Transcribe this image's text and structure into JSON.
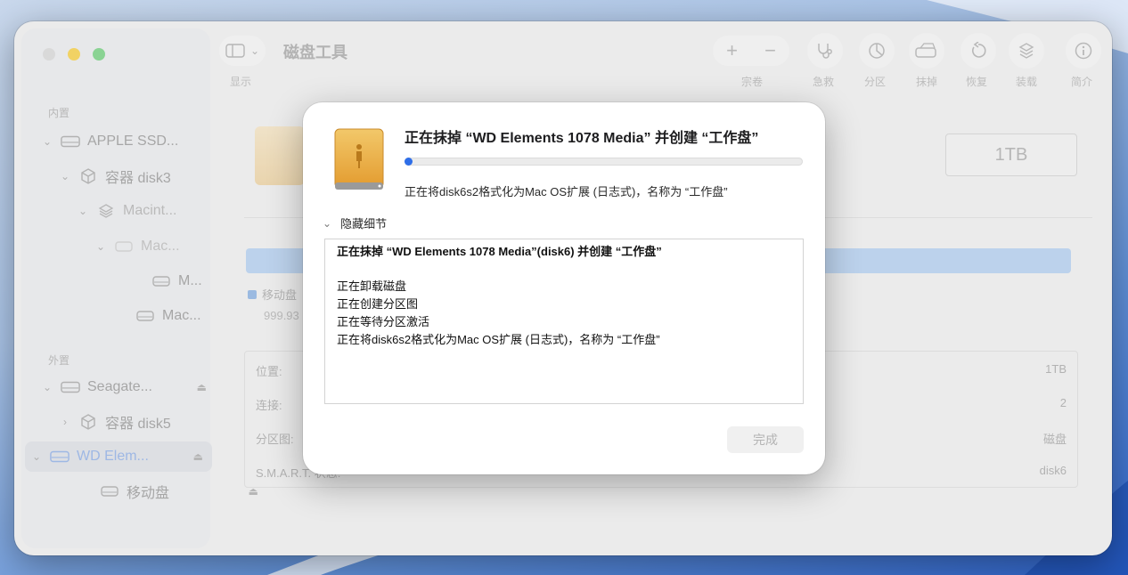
{
  "toolbar": {
    "title": "磁盘工具",
    "view_label": "显示",
    "volume_label": "宗卷",
    "first_aid_label": "急救",
    "partition_label": "分区",
    "erase_label": "抹掉",
    "restore_label": "恢复",
    "mount_label": "装载",
    "info_label": "简介"
  },
  "sidebar": {
    "internal_header": "内置",
    "external_header": "外置",
    "items": [
      {
        "label": "APPLE SSD..."
      },
      {
        "label": "容器 disk3"
      },
      {
        "label": "Macint..."
      },
      {
        "label": "Mac..."
      },
      {
        "label": "M..."
      },
      {
        "label": "Mac..."
      },
      {
        "label": "Seagate..."
      },
      {
        "label": "容器 disk5"
      },
      {
        "label": "WD Elem..."
      },
      {
        "label": "移动盘"
      }
    ]
  },
  "main": {
    "capacity": "1TB",
    "legend_name": "移动盘",
    "legend_size": "999.93",
    "info": [
      {
        "key": "位置:",
        "value": "1TB"
      },
      {
        "key": "连接:",
        "value": "2"
      },
      {
        "key": "分区图:",
        "value": "磁盘"
      },
      {
        "key": "S.M.A.R.T. 状态:",
        "value": "disk6"
      }
    ]
  },
  "dialog": {
    "title": "正在抹掉 “WD Elements 1078 Media” 并创建 “工作盘”",
    "progress": 0.02,
    "status": "正在将disk6s2格式化为Mac OS扩展 (日志式)，名称为 “工作盘”",
    "details_toggle": "隐藏细节",
    "log": [
      "正在抹掉 “WD Elements 1078 Media”(disk6) 并创建 “工作盘”",
      "",
      "正在卸载磁盘",
      "正在创建分区图",
      "正在等待分区激活",
      "正在将disk6s2格式化为Mac OS扩展 (日志式)，名称为 “工作盘”"
    ],
    "done_button": "完成"
  },
  "colors": {
    "accent": "#2e6ee8",
    "drive_orange": "#e7a63a",
    "selection_text": "#7fa2e0"
  }
}
